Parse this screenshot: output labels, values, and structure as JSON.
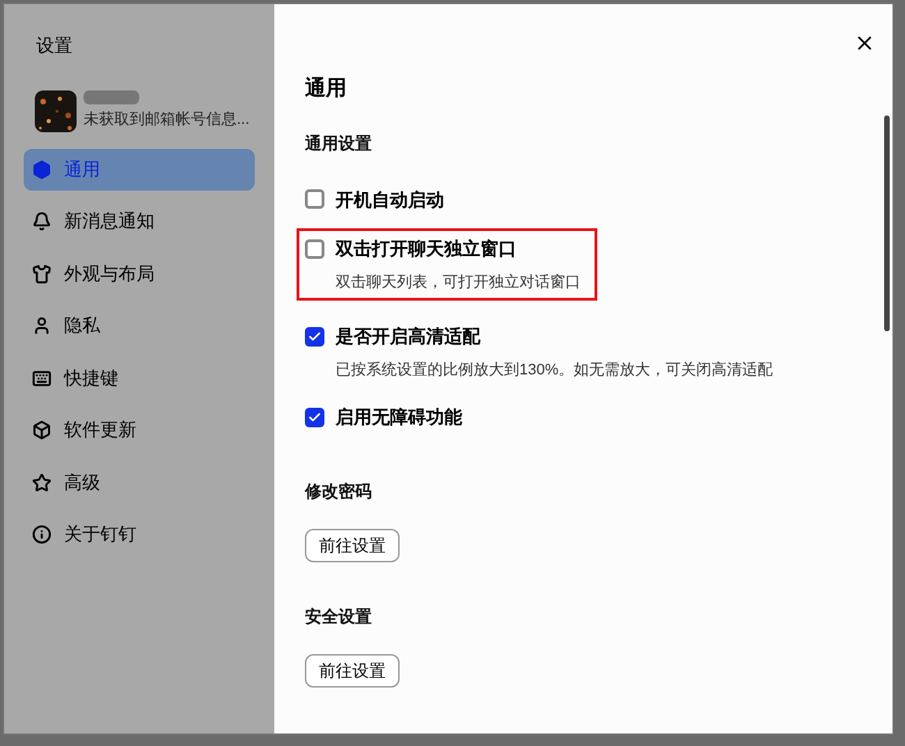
{
  "window": {
    "title": "设置"
  },
  "account": {
    "subtitle": "未获取到邮箱帐号信息..."
  },
  "sidebar": {
    "items": [
      {
        "label": "通用",
        "selected": true
      },
      {
        "label": "新消息通知",
        "selected": false
      },
      {
        "label": "外观与布局",
        "selected": false
      },
      {
        "label": "隐私",
        "selected": false
      },
      {
        "label": "快捷键",
        "selected": false
      },
      {
        "label": "软件更新",
        "selected": false
      },
      {
        "label": "高级",
        "selected": false
      },
      {
        "label": "关于钉钉",
        "selected": false
      }
    ]
  },
  "content": {
    "title": "通用",
    "sections": [
      {
        "heading": "通用设置",
        "items": [
          {
            "kind": "checkbox",
            "label": "开机自动启动",
            "checked": false,
            "highlighted": false
          },
          {
            "kind": "checkbox",
            "label": "双击打开聊天独立窗口",
            "description": "双击聊天列表，可打开独立对话窗口",
            "checked": false,
            "highlighted": true
          },
          {
            "kind": "checkbox",
            "label": "是否开启高清适配",
            "description": "已按系统设置的比例放大到130%。如无需放大，可关闭高清适配",
            "checked": true,
            "highlighted": false
          },
          {
            "kind": "checkbox",
            "label": "启用无障碍功能",
            "checked": true,
            "highlighted": false
          }
        ]
      },
      {
        "heading": "修改密码",
        "items": [
          {
            "kind": "button",
            "label": "前往设置"
          }
        ]
      },
      {
        "heading": "安全设置",
        "items": [
          {
            "kind": "button",
            "label": "前往设置"
          }
        ]
      }
    ]
  }
}
